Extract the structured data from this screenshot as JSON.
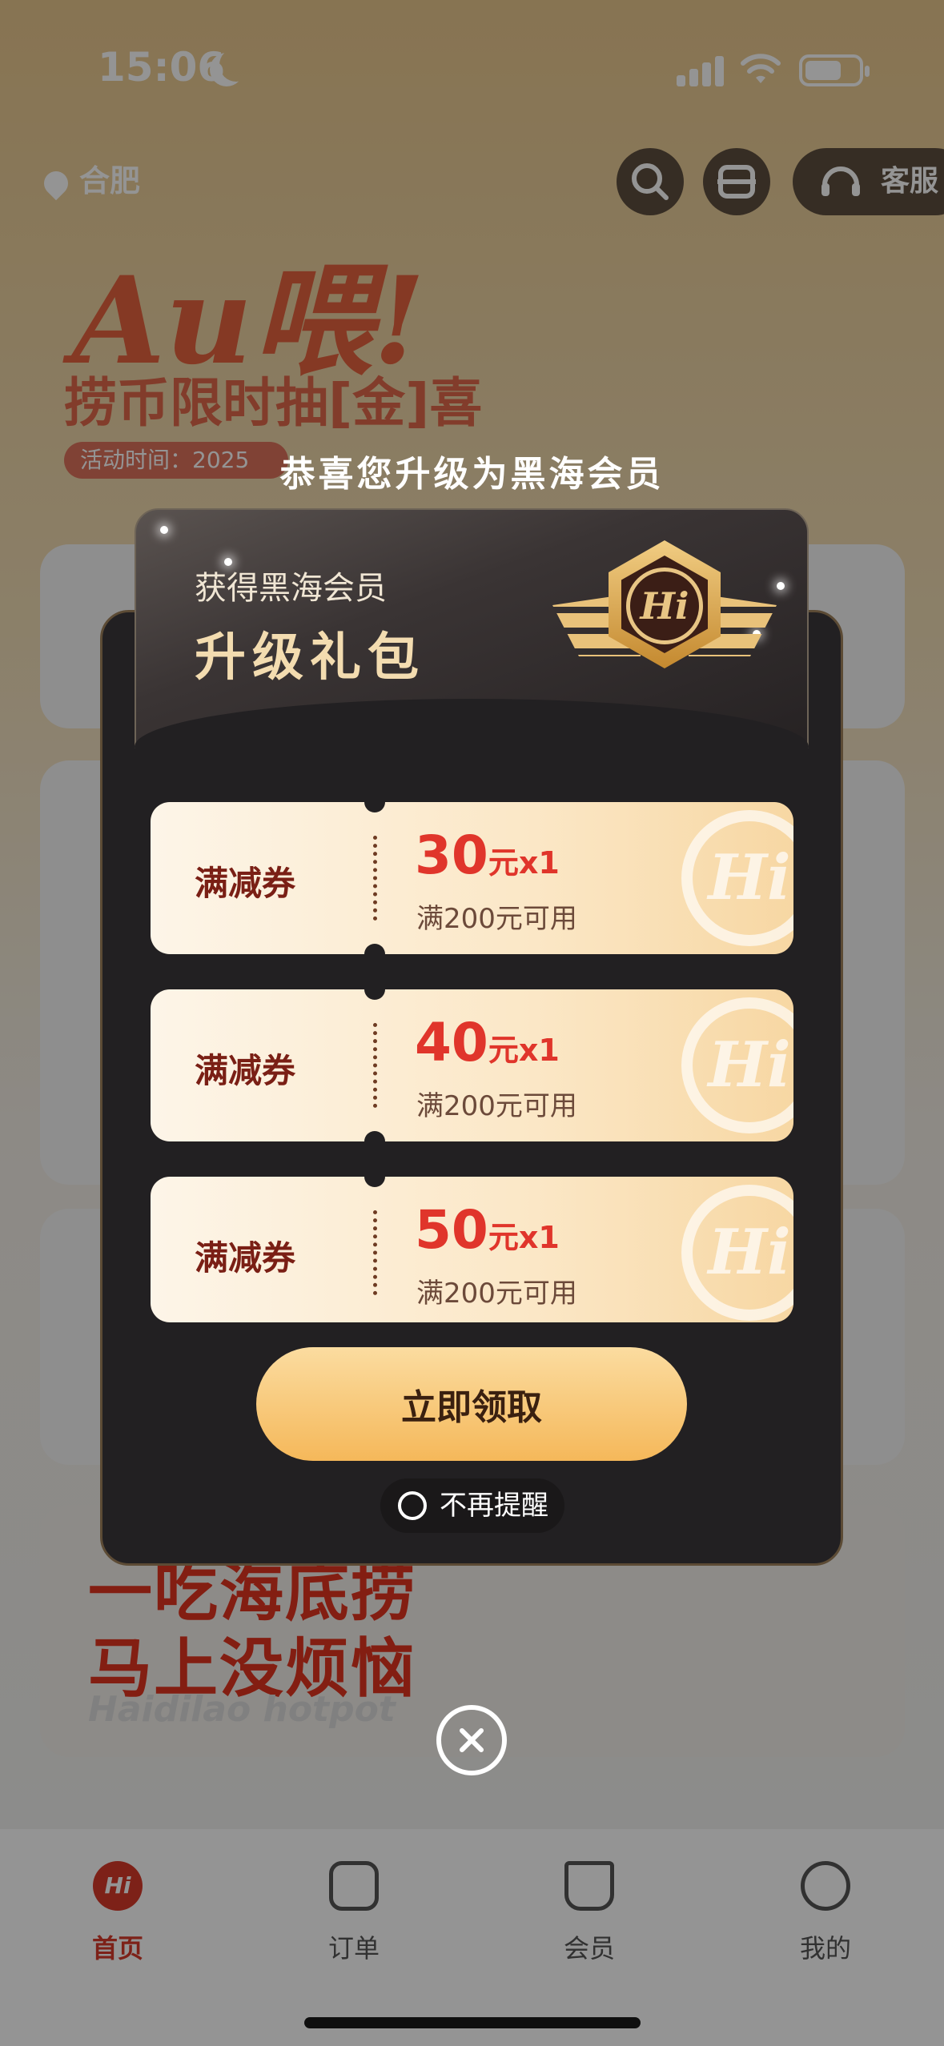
{
  "status_bar": {
    "time": "15:06",
    "icons": [
      "moon-icon",
      "signal-icon",
      "wifi-icon",
      "battery-icon"
    ]
  },
  "background": {
    "location": "合肥",
    "service_label": "客服",
    "banner": {
      "title": "Au喂!",
      "subtitle": "捞币限时抽[金]喜",
      "activity_time": "活动时间：2025"
    },
    "bottom_banner": {
      "line1": "一吃海底捞",
      "line2": "马上没烦恼",
      "line3": "Haidilao hotpot"
    },
    "tabbar": [
      {
        "label": "首页",
        "icon": "home-hi-icon",
        "active": true
      },
      {
        "label": "订单",
        "icon": "order-icon",
        "active": false
      },
      {
        "label": "会员",
        "icon": "member-icon",
        "active": false
      },
      {
        "label": "我的",
        "icon": "profile-icon",
        "active": false
      }
    ]
  },
  "modal": {
    "congrats": "恭喜您升级为黑海会员",
    "header_subtitle": "获得黑海会员",
    "header_title": "升级礼包",
    "badge_text": "Hi",
    "coupons": [
      {
        "type": "满减券",
        "amount": "30",
        "unit": "元x1",
        "condition": "满200元可用"
      },
      {
        "type": "满减券",
        "amount": "40",
        "unit": "元x1",
        "condition": "满200元可用"
      },
      {
        "type": "满减券",
        "amount": "50",
        "unit": "元x1",
        "condition": "满200元可用"
      }
    ],
    "claim_button": "立即领取",
    "no_remind": "不再提醒"
  },
  "colors": {
    "accent_red": "#e0352b",
    "gold": "#f5b85a",
    "modal_bg": "#222022"
  }
}
